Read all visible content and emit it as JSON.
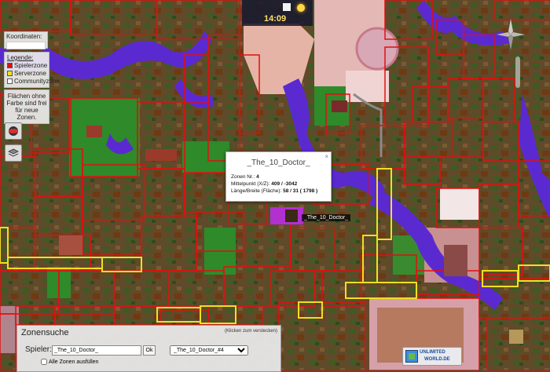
{
  "clock": {
    "time": "14:09"
  },
  "coordinates": {
    "label": "Koordinaten:"
  },
  "legend": {
    "title": "Legende:",
    "items": [
      {
        "label": "Spielerzone",
        "color": "#e01010"
      },
      {
        "label": "Serverzone",
        "color": "#f0e020"
      },
      {
        "label": "Communityzone",
        "color": "#ffffff"
      }
    ]
  },
  "free_hint": "Flächen ohne Farbe sind frei für neue Zonen.",
  "popup": {
    "name": "_The_10_Doctor_",
    "close": "×",
    "zone_label": "Zonen Nr.:",
    "zone_value": "4",
    "center_label": "Mittelpunkt (X/Z):",
    "center_value": "409 / -3042",
    "size_label": "Länge/Breite (Fläche):",
    "size_value": "58 / 31 ( 1798 )"
  },
  "player_marker": {
    "name": "_The_10_Doctor_"
  },
  "zone_search": {
    "title": "Zonensuche",
    "hide_hint": "(Klicken zum verstecken)",
    "player_label": "Spieler:",
    "player_value": "_The_10_Doctor_",
    "ok_label": "Ok",
    "selected_zone": "_The_10_Doctor_#4",
    "fill_all_label": "Alle Zonen ausfüllen"
  },
  "logo": {
    "line1": "UNLIMITED",
    "line2": "WORLD.DE"
  },
  "colors": {
    "player_zone": "#e01010",
    "server_zone": "#f0e020",
    "water": "#5a2ad0",
    "path": "#e8b8b0",
    "popup_marker": "#b330d0"
  }
}
